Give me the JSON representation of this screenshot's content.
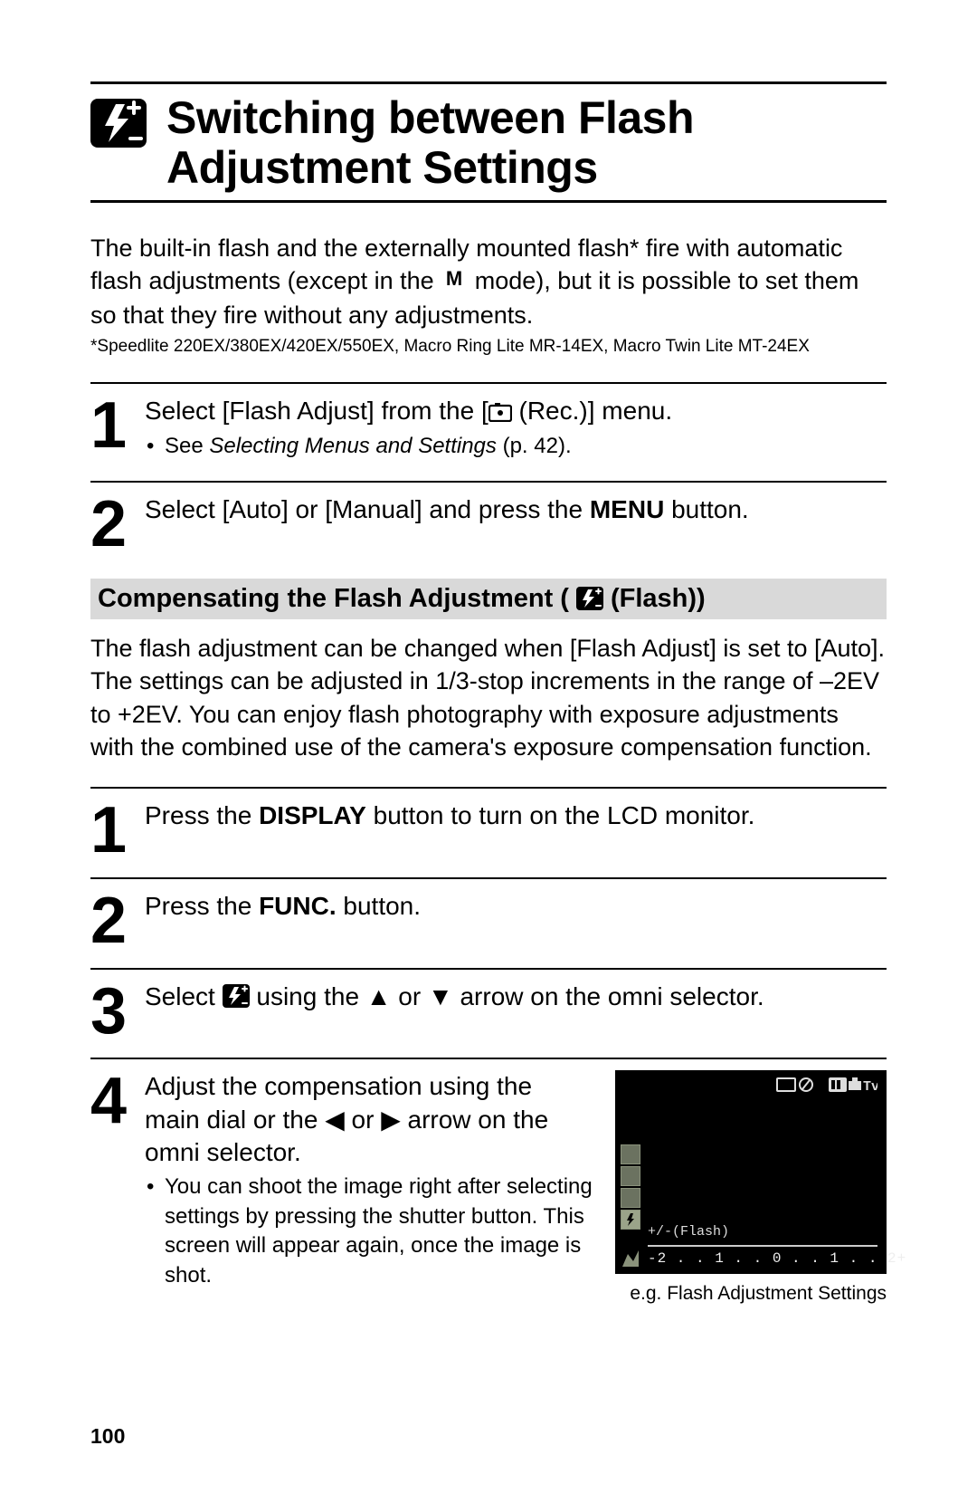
{
  "title": {
    "icon": "flash-adjust-icon",
    "text": "Switching between Flash Adjustment Settings"
  },
  "intro": {
    "part1": "The built-in flash and the externally mounted flash* fire with automatic flash adjustments (except in the ",
    "mode_label": "M",
    "part2": " mode), but it is possible to set them so that they fire without any adjustments."
  },
  "footnote": "*Speedlite 220EX/380EX/420EX/550EX, Macro Ring Lite MR-14EX, Macro Twin Lite MT-24EX",
  "steps_primary": [
    {
      "num": "1",
      "head_pre": "Select [Flash Adjust] from the [",
      "head_post": " (Rec.)] menu.",
      "bullet_pre": "See ",
      "bullet_italic": "Selecting Menus and Settings",
      "bullet_post": " (p. 42)."
    },
    {
      "num": "2",
      "head_pre": "Select [Auto] or [Manual] and press the ",
      "head_bold": "MENU",
      "head_post": " button."
    }
  ],
  "subsection": {
    "title_pre": "Compensating the Flash Adjustment (",
    "title_post": " (Flash))",
    "desc": "The flash adjustment can be changed when [Flash Adjust] is set to [Auto]. The settings can be adjusted in 1/3-stop increments in the range of –2EV to +2EV. You can enjoy flash photography with exposure adjustments with the combined use of the camera's exposure compensation function."
  },
  "steps_secondary": [
    {
      "num": "1",
      "segs": [
        {
          "t": "Press the "
        },
        {
          "t": "DISPLAY",
          "bold": true
        },
        {
          "t": " button to turn on the LCD monitor."
        }
      ]
    },
    {
      "num": "2",
      "segs": [
        {
          "t": "Press the "
        },
        {
          "t": "FUNC.",
          "bold": true
        },
        {
          "t": " button."
        }
      ]
    },
    {
      "num": "3",
      "segs": [
        {
          "t": "Select "
        },
        {
          "icon": "flash-compensation-icon"
        },
        {
          "t": " using the ▲ or ▼ arrow on the omni selector."
        }
      ]
    },
    {
      "num": "4",
      "head": "Adjust the compensation using the main dial or the ◀ or ▶ arrow on the omni selector.",
      "bullet": "You can shoot the image right after selecting settings by pressing the shutter button. This screen will appear again, once the image is shot."
    }
  ],
  "lcd": {
    "top_left_group": "quality-size-icons",
    "top_right_group": "mode-icons",
    "side_items": [
      "",
      "",
      "",
      ""
    ],
    "label": "+/-(Flash)",
    "scale": "-2 . . 1 . . 0 . . 1 . . 2+",
    "caption": "e.g. Flash Adjustment Settings"
  },
  "page_number": "100"
}
